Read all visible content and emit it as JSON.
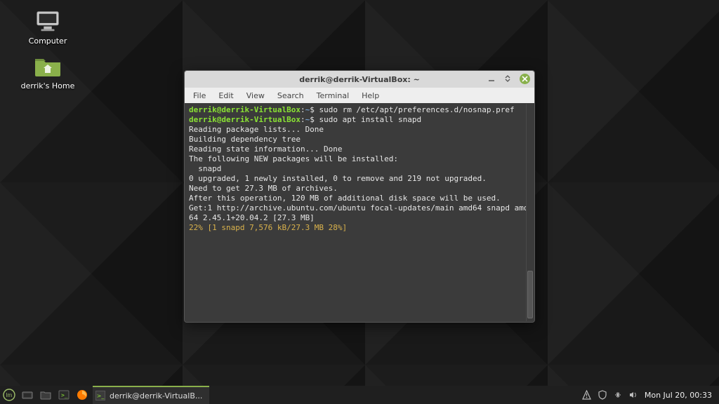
{
  "desktop": {
    "icons": {
      "computer": {
        "label": "Computer"
      },
      "home": {
        "label": "derrik's Home"
      }
    }
  },
  "window": {
    "title": "derrik@derrik-VirtualBox: ~",
    "menu": {
      "file": "File",
      "edit": "Edit",
      "view": "View",
      "search": "Search",
      "terminal": "Terminal",
      "help": "Help"
    }
  },
  "terminal": {
    "prompt": {
      "userhost": "derrik@derrik-VirtualBox",
      "colon": ":",
      "path": "~",
      "symbol": "$"
    },
    "cmd1": "sudo rm /etc/apt/preferences.d/nosnap.pref",
    "cmd2": "sudo apt install snapd",
    "out1": "Reading package lists... Done",
    "out2": "Building dependency tree",
    "out3": "Reading state information... Done",
    "out4": "The following NEW packages will be installed:",
    "out5": "  snapd",
    "out6": "0 upgraded, 1 newly installed, 0 to remove and 219 not upgraded.",
    "out7": "Need to get 27.3 MB of archives.",
    "out8": "After this operation, 120 MB of additional disk space will be used.",
    "out9": "Get:1 http://archive.ubuntu.com/ubuntu focal-updates/main amd64 snapd amd64 2.45.1+20.04.2 [27.3 MB]",
    "progress": "22% [1 snapd 7,576 kB/27.3 MB 28%]"
  },
  "panel": {
    "task_label": "derrik@derrik-VirtualB...",
    "clock": "Mon Jul 20, 00:33"
  },
  "colors": {
    "mint_green": "#8ab04b",
    "term_green": "#8ae234",
    "term_blue": "#729fcf",
    "progress": "#d9b24c"
  }
}
